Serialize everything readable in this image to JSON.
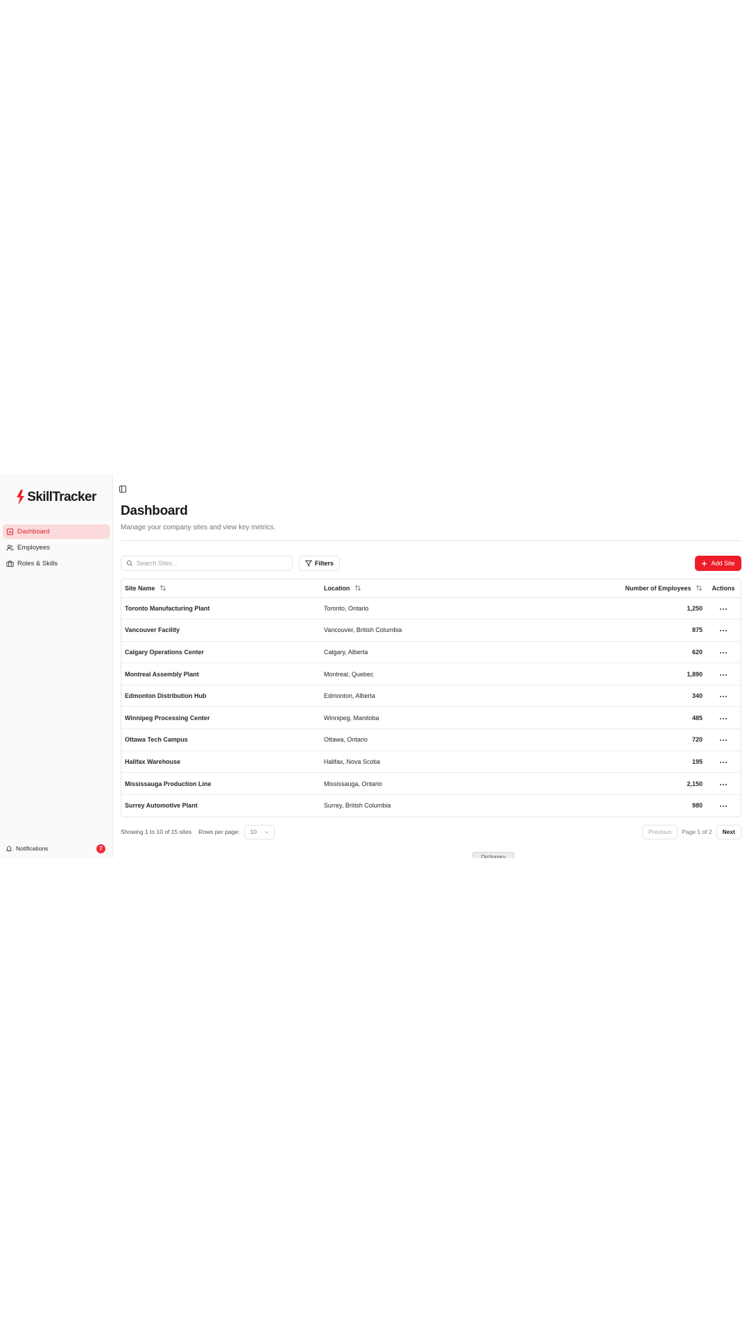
{
  "brand": {
    "name": "SkillTracker",
    "accent": "#ef1d2a"
  },
  "sidebar": {
    "items": [
      {
        "label": "Dashboard",
        "icon": "dashboard-icon",
        "active": true
      },
      {
        "label": "Employees",
        "icon": "users-icon",
        "active": false
      },
      {
        "label": "Roles & Skills",
        "icon": "briefcase-icon",
        "active": false
      }
    ],
    "notifications": {
      "label": "Notifications",
      "count": "7",
      "icon": "bell-icon"
    }
  },
  "header": {
    "title": "Dashboard",
    "subtitle": "Manage your company sites and view key metrics."
  },
  "toolbar": {
    "search_placeholder": "Search Sites...",
    "filters_label": "Filters",
    "add_label": "Add Site"
  },
  "table": {
    "columns": {
      "name": "Site Name",
      "location": "Location",
      "employees": "Number of Employees",
      "actions": "Actions"
    },
    "rows": [
      {
        "name": "Toronto Manufacturing Plant",
        "location": "Toronto, Ontario",
        "employees": "1,250"
      },
      {
        "name": "Vancouver Facility",
        "location": "Vancouver, British Columbia",
        "employees": "875"
      },
      {
        "name": "Calgary Operations Center",
        "location": "Calgary, Alberta",
        "employees": "620"
      },
      {
        "name": "Montreal Assembly Plant",
        "location": "Montreal, Quebec",
        "employees": "1,890"
      },
      {
        "name": "Edmonton Distribution Hub",
        "location": "Edmonton, Alberta",
        "employees": "340"
      },
      {
        "name": "Winnipeg Processing Center",
        "location": "Winnipeg, Manitoba",
        "employees": "485"
      },
      {
        "name": "Ottawa Tech Campus",
        "location": "Ottawa, Ontario",
        "employees": "720"
      },
      {
        "name": "Halifax Warehouse",
        "location": "Halifax, Nova Scotia",
        "employees": "195"
      },
      {
        "name": "Mississauga Production Line",
        "location": "Mississauga, Ontario",
        "employees": "2,150"
      },
      {
        "name": "Surrey Automotive Plant",
        "location": "Surrey, British Columbia",
        "employees": "980"
      }
    ]
  },
  "footer": {
    "showing": "Showing 1 to 10 of 15 sites",
    "rows_label": "Rows per page:",
    "rows_value": "10",
    "previous": "Previous",
    "page_info": "Page 1 of 2",
    "next": "Next"
  },
  "dictionary_tab": "Dictionary"
}
